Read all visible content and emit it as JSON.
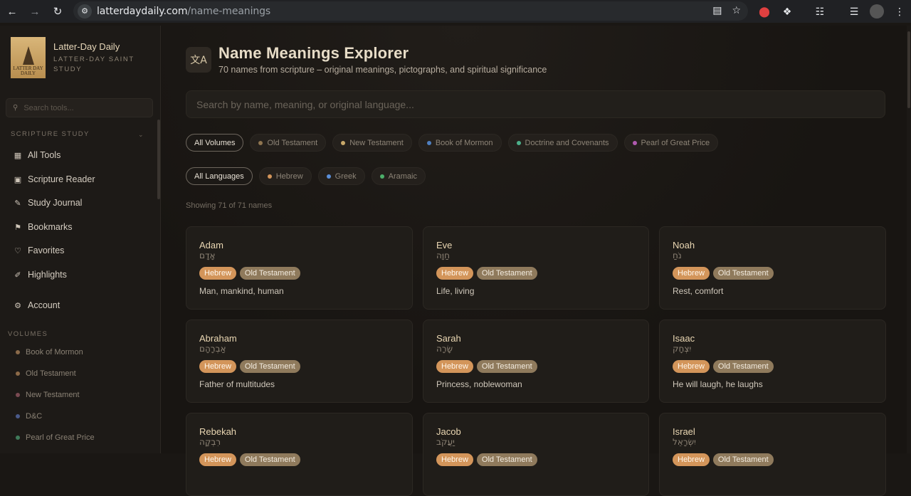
{
  "browser": {
    "url_domain": "latterdaydaily.com",
    "url_path": "/name-meanings"
  },
  "brand": {
    "title": "Latter-Day Daily",
    "subtitle": "LATTER-DAY SAINT STUDY",
    "logo_text": "LATTER DAY DAILY"
  },
  "sidebar": {
    "search_placeholder": "Search tools...",
    "section_scripture": "SCRIPTURE STUDY",
    "nav": [
      {
        "label": "All Tools",
        "icon": "grid-icon"
      },
      {
        "label": "Scripture Reader",
        "icon": "book-icon"
      },
      {
        "label": "Study Journal",
        "icon": "journal-icon"
      },
      {
        "label": "Bookmarks",
        "icon": "bookmark-icon"
      },
      {
        "label": "Favorites",
        "icon": "heart-icon"
      },
      {
        "label": "Highlights",
        "icon": "highlighter-icon"
      }
    ],
    "account": "Account",
    "section_volumes": "VOLUMES",
    "volumes": [
      {
        "label": "Book of Mormon",
        "color": "#8a6a4a"
      },
      {
        "label": "Old Testament",
        "color": "#8c6a48"
      },
      {
        "label": "New Testament",
        "color": "#7a4a52"
      },
      {
        "label": "D&C",
        "color": "#4a5a8a"
      },
      {
        "label": "Pearl of Great Price",
        "color": "#3f7a5a"
      }
    ]
  },
  "main": {
    "title": "Name Meanings Explorer",
    "subtitle": "70 names from scripture – original meanings, pictographs, and spiritual significance",
    "search_placeholder": "Search by name, meaning, or original language...",
    "volume_filters": [
      {
        "label": "All Volumes",
        "active": true,
        "color": ""
      },
      {
        "label": "Old Testament",
        "active": false,
        "color": "#8f7550"
      },
      {
        "label": "New Testament",
        "active": false,
        "color": "#c8a86a"
      },
      {
        "label": "Book of Mormon",
        "active": false,
        "color": "#4f7fc0"
      },
      {
        "label": "Doctrine and Covenants",
        "active": false,
        "color": "#4caf8a"
      },
      {
        "label": "Pearl of Great Price",
        "active": false,
        "color": "#b05ab0"
      }
    ],
    "language_filters": [
      {
        "label": "All Languages",
        "active": true,
        "color": ""
      },
      {
        "label": "Hebrew",
        "active": false,
        "color": "#d3955a"
      },
      {
        "label": "Greek",
        "active": false,
        "color": "#5a8fd8"
      },
      {
        "label": "Aramaic",
        "active": false,
        "color": "#4caf6a"
      }
    ],
    "showing": "Showing 71 of 71 names",
    "names": [
      {
        "name": "Adam",
        "original": "אָדָם",
        "language": "Hebrew",
        "volume": "Old Testament",
        "meaning": "Man, mankind, human"
      },
      {
        "name": "Eve",
        "original": "חַוָּה",
        "language": "Hebrew",
        "volume": "Old Testament",
        "meaning": "Life, living"
      },
      {
        "name": "Noah",
        "original": "נֹחַ",
        "language": "Hebrew",
        "volume": "Old Testament",
        "meaning": "Rest, comfort"
      },
      {
        "name": "Abraham",
        "original": "אַבְרָהָם",
        "language": "Hebrew",
        "volume": "Old Testament",
        "meaning": "Father of multitudes"
      },
      {
        "name": "Sarah",
        "original": "שָׂרָה",
        "language": "Hebrew",
        "volume": "Old Testament",
        "meaning": "Princess, noblewoman"
      },
      {
        "name": "Isaac",
        "original": "יִצְחָק",
        "language": "Hebrew",
        "volume": "Old Testament",
        "meaning": "He will laugh, he laughs"
      },
      {
        "name": "Rebekah",
        "original": "רִבְקָה",
        "language": "Hebrew",
        "volume": "Old Testament",
        "meaning": ""
      },
      {
        "name": "Jacob",
        "original": "יַעֲקֹב",
        "language": "Hebrew",
        "volume": "Old Testament",
        "meaning": ""
      },
      {
        "name": "Israel",
        "original": "יִשְׂרָאֵל",
        "language": "Hebrew",
        "volume": "Old Testament",
        "meaning": ""
      }
    ]
  }
}
